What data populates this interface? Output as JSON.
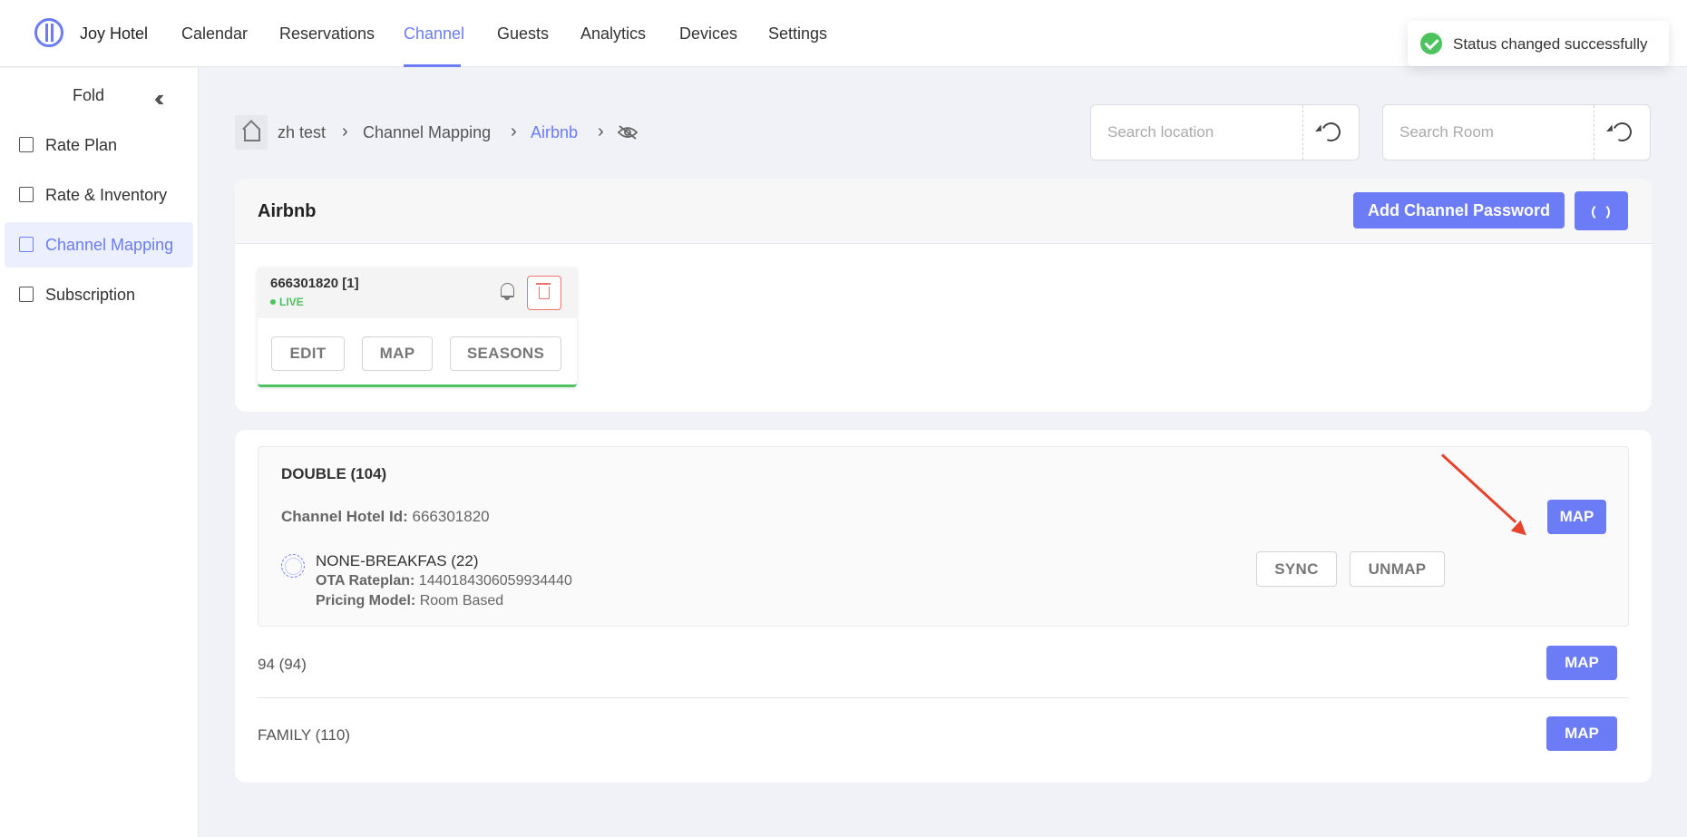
{
  "app": {
    "name": "Joy Hotel"
  },
  "nav": {
    "items": [
      "Calendar",
      "Reservations",
      "Channel",
      "Guests",
      "Analytics",
      "Devices",
      "Settings"
    ],
    "active": "Channel"
  },
  "toast": {
    "message": "Status changed successfully",
    "icon": "check-circle-icon"
  },
  "sidebar": {
    "fold_label": "Fold",
    "items": [
      {
        "label": "Rate Plan",
        "icon": "rate-plan-icon"
      },
      {
        "label": "Rate & Inventory",
        "icon": "rate-inventory-icon"
      },
      {
        "label": "Channel Mapping",
        "icon": "channel-mapping-icon",
        "active": true
      },
      {
        "label": "Subscription",
        "icon": "subscription-icon"
      }
    ]
  },
  "breadcrumb": {
    "items": [
      "zh test",
      "Channel Mapping",
      "Airbnb"
    ],
    "active": "Airbnb"
  },
  "search": {
    "location_placeholder": "Search location",
    "room_placeholder": "Search Room"
  },
  "channel": {
    "title": "Airbnb",
    "add_password_label": "Add Channel Password",
    "property": {
      "id_label": "666301820 [1]",
      "status": "LIVE",
      "actions": [
        "EDIT",
        "MAP",
        "SEASONS"
      ]
    }
  },
  "rooms": {
    "double": {
      "title": "DOUBLE (104)",
      "hotel_id_label": "Channel Hotel Id:",
      "hotel_id": "666301820",
      "map_label": "MAP",
      "rate": {
        "name": "NONE-BREAKFAS (22)",
        "ota_label": "OTA Rateplan:",
        "ota_value": "1440184306059934440",
        "pricing_label": "Pricing Model:",
        "pricing_value": "Room Based",
        "sync_label": "SYNC",
        "unmap_label": "UNMAP"
      }
    },
    "others": [
      {
        "title": "94 (94)",
        "map_label": "MAP"
      },
      {
        "title": "FAMILY (110)",
        "map_label": "MAP"
      }
    ]
  },
  "colors": {
    "accent": "#6b7cf6",
    "live": "#4cc35f",
    "danger": "#f07070",
    "annotation_arrow": "#e5432c"
  }
}
